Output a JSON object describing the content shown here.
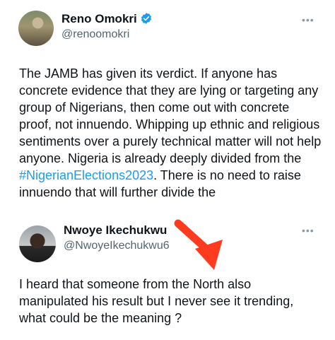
{
  "tweet_top": {
    "author_name": "Reno Omokri",
    "author_handle": "@renoomokri",
    "more_label": "•••",
    "text_before_hashtag": "The JAMB has given its verdict. If anyone has concrete evidence that they are lying or targeting any group of Nigerians, then come out with concrete proof, not innuendo. Whipping up ethnic and religious sentiments over a purely technical matter will not help anyone. Nigeria is already deeply divided from the ",
    "hashtag": "#NigerianElections2023",
    "text_after_hashtag": ". There is no need to raise innuendo that will further divide the",
    "verified_color": "#1d9bf0",
    "hashtag_color": "#1d9bf0"
  },
  "tweet_bottom": {
    "author_name": "Nwoye Ikechukwu",
    "author_handle": "@NwoyeIkechukwu6",
    "more_label": "•••",
    "text": "I heard that someone from the North also manipulated his result but I never see it trending, what could be the meaning ?"
  },
  "annotation": {
    "arrow_color": "#ff3b1f"
  }
}
